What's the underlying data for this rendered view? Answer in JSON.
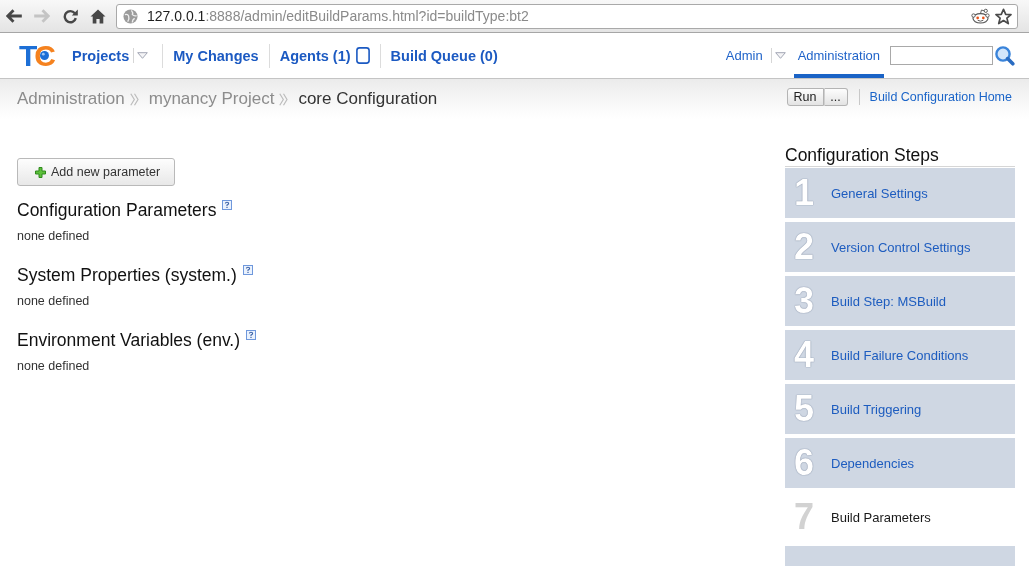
{
  "browser": {
    "buttons": [
      {
        "kind": "back",
        "disabled": false
      },
      {
        "kind": "forward",
        "disabled": true
      },
      {
        "kind": "reload",
        "disabled": false
      },
      {
        "kind": "home",
        "disabled": false
      }
    ],
    "address": {
      "host": "127.0.0.1",
      "path": ":8888/admin/editBuildParams.html?id=buildType:bt2"
    }
  },
  "header": {
    "logo": [
      {
        "text": "T",
        "color": "#1d6fd6"
      },
      {
        "text": "C",
        "color": "#f5821f"
      }
    ],
    "nav": [
      {
        "label": "Projects",
        "kind": "menu",
        "selected": false
      },
      {
        "label": "My Changes",
        "kind": "link",
        "selected": false
      },
      {
        "label": "Agents (1)",
        "kind": "agents",
        "selected": false
      },
      {
        "label": "Build Queue (0)",
        "kind": "link",
        "selected": false
      }
    ],
    "user_nav": [
      {
        "label": "Admin",
        "kind": "menu",
        "selected": false
      },
      {
        "label": "Administration",
        "kind": "link",
        "selected": true
      }
    ]
  },
  "breadcrumbs": [
    {
      "label": "Administration",
      "current": false
    },
    {
      "label": "mynancy Project",
      "current": false
    },
    {
      "label": "core Configuration",
      "current": true
    }
  ],
  "actions": {
    "run_button": {
      "label": "Run",
      "more_label": "..."
    },
    "home_link": "Build Configuration Home"
  },
  "parameters": {
    "add_button": "Add new parameter",
    "sections": [
      {
        "title": "Configuration Parameters",
        "empty_text": "none defined"
      },
      {
        "title": "System Properties (system.)",
        "empty_text": "none defined"
      },
      {
        "title": "Environment Variables (env.)",
        "empty_text": "none defined"
      }
    ]
  },
  "steps": {
    "title": "Configuration Steps",
    "items": [
      {
        "number": "1",
        "label": "General Settings",
        "selected": false
      },
      {
        "number": "2",
        "label": "Version Control Settings",
        "selected": false
      },
      {
        "number": "3",
        "label": "Build Step: MSBuild",
        "selected": false
      },
      {
        "number": "4",
        "label": "Build Failure Conditions",
        "selected": false
      },
      {
        "number": "5",
        "label": "Build Triggering",
        "selected": false
      },
      {
        "number": "6",
        "label": "Dependencies",
        "selected": false
      },
      {
        "number": "7",
        "label": "Build Parameters",
        "selected": true
      },
      {
        "selected": false
      }
    ]
  }
}
